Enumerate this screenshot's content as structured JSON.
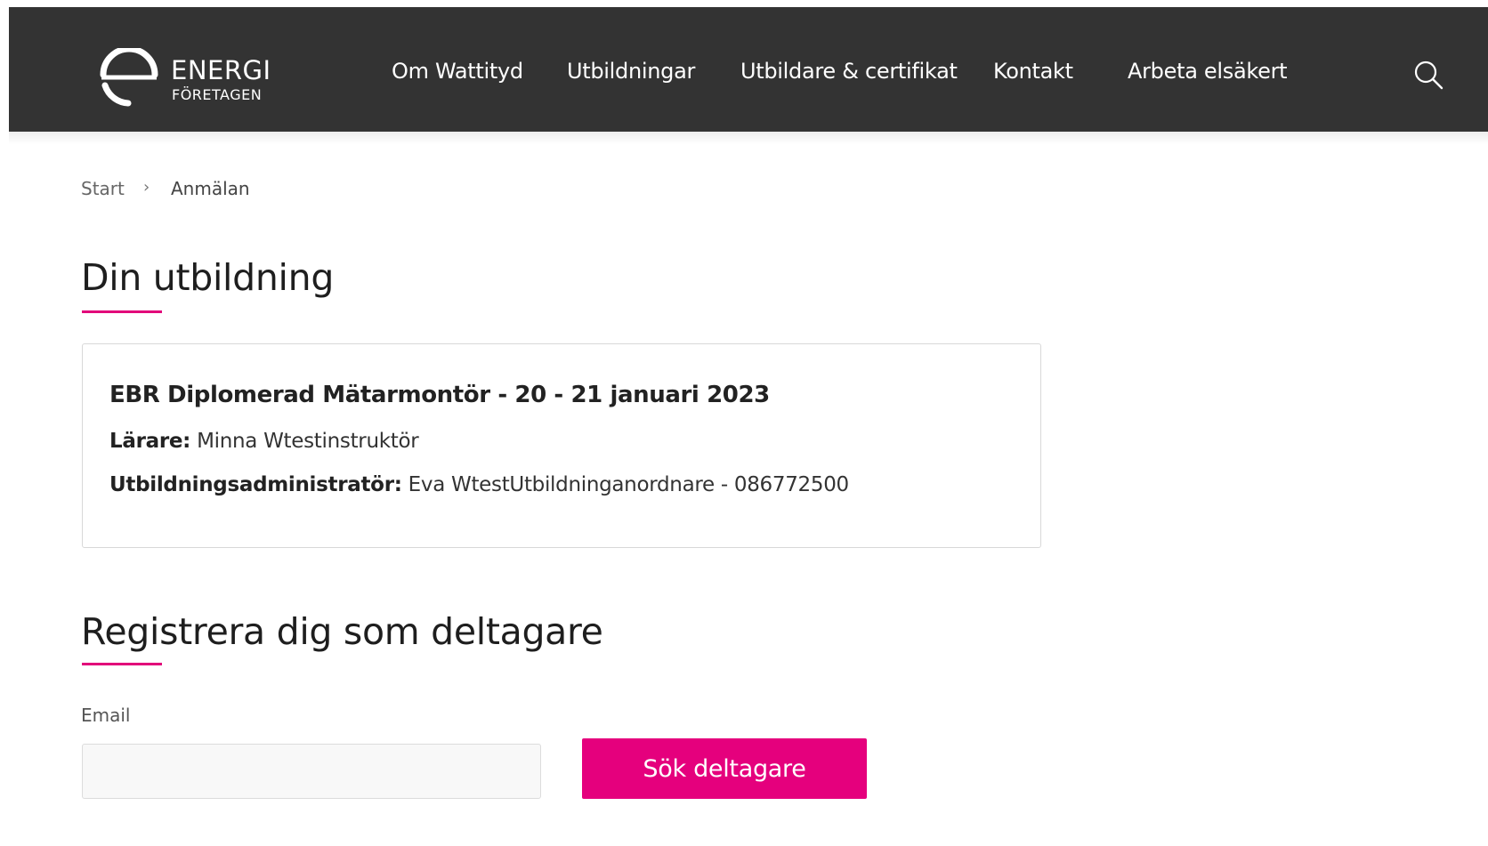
{
  "header": {
    "logo": {
      "line1": "ENERGI",
      "line2": "FÖRETAGEN"
    },
    "nav": [
      {
        "label": "Om Wattityd"
      },
      {
        "label": "Utbildningar"
      },
      {
        "label": "Utbildare & certifikat"
      },
      {
        "label": "Kontakt"
      },
      {
        "label": "Arbeta elsäkert"
      }
    ],
    "search_icon": "search-icon"
  },
  "breadcrumb": {
    "start": "Start",
    "separator": "›",
    "current": "Anmälan"
  },
  "course_section": {
    "heading": "Din utbildning",
    "title": "EBR Diplomerad Mätarmontör - 20 - 21 januari 2023",
    "teacher_label": "Lärare:",
    "teacher_value": "Minna Wtestinstruktör",
    "admin_label": "Utbildningsadministratör:",
    "admin_value": "Eva WtestUtbildninganordnare - 086772500"
  },
  "register_section": {
    "heading": "Registrera dig som deltagare",
    "email_label": "Email",
    "email_value": "",
    "search_button": "Sök deltagare"
  },
  "colors": {
    "header_bg": "#333333",
    "accent": "#e5007d"
  }
}
